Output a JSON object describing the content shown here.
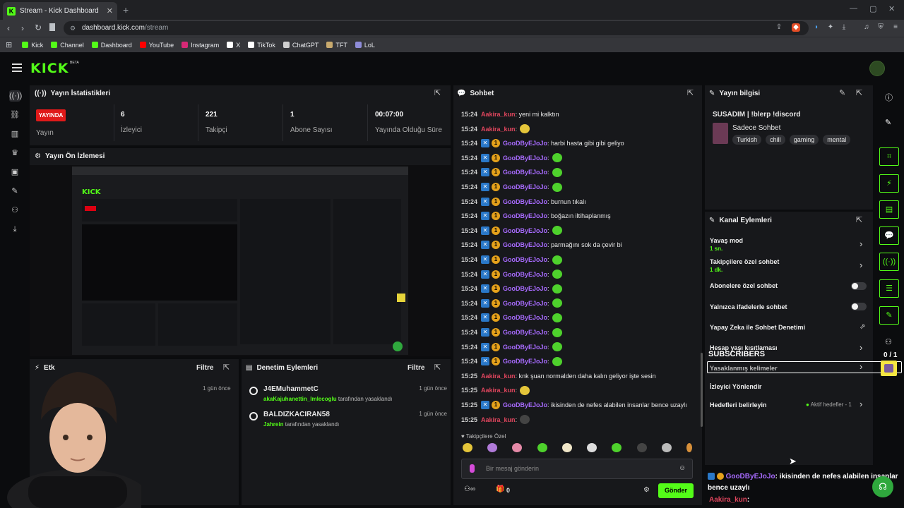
{
  "browser": {
    "tab_title": "Stream - Kick Dashboard",
    "url_domain": "dashboard.kick.com",
    "url_path": "/stream"
  },
  "bookmarks": [
    {
      "label": "Kick",
      "color": "#53fc18"
    },
    {
      "label": "Channel",
      "color": "#53fc18"
    },
    {
      "label": "Dashboard",
      "color": "#53fc18"
    },
    {
      "label": "YouTube",
      "color": "#ff0000"
    },
    {
      "label": "Instagram",
      "color": "#d62976"
    },
    {
      "label": "X",
      "color": "#ffffff"
    },
    {
      "label": "TikTok",
      "color": "#ffffff"
    },
    {
      "label": "ChatGPT",
      "color": "#cfcfcf"
    },
    {
      "label": "TFT",
      "color": "#c8aa6e"
    },
    {
      "label": "LoL",
      "color": "#8e8cd8"
    }
  ],
  "kick": {
    "logo": "KICK",
    "beta": "BETA"
  },
  "stats": {
    "title": "Yayın İstatistikleri",
    "live_badge": "YAYINDA",
    "items": [
      {
        "value": "",
        "label": "Yayın"
      },
      {
        "value": "6",
        "label": "İzleyici"
      },
      {
        "value": "221",
        "label": "Takipçi"
      },
      {
        "value": "1",
        "label": "Abone Sayısı"
      },
      {
        "value": "00:07:00",
        "label": "Yayında Olduğu Süre"
      }
    ]
  },
  "preview": {
    "title": "Yayın Ön İzlemesi"
  },
  "events": {
    "title": "Etk",
    "filter": "Filtre",
    "time": "1 gün önce"
  },
  "moderation": {
    "title": "Denetim Eylemleri",
    "filter": "Filtre",
    "items": [
      {
        "user": "J4EMuhammetC",
        "by": "akaKajuhanettin_lmlecoglu",
        "action": "tarafından yasaklandı",
        "time": "1 gün önce"
      },
      {
        "user": "BALDIZKACIRAN58",
        "by": "Jahrein",
        "action": "tarafından yasaklandı",
        "time": "1 gün önce"
      }
    ]
  },
  "chat": {
    "title": "Sohbet",
    "messages": [
      {
        "time": "15:24",
        "user": "Aakira_kun",
        "color": "#e0455d",
        "badges": false,
        "text": ": yeni mi kalktın",
        "emote": ""
      },
      {
        "time": "15:24",
        "user": "Aakira_kun",
        "color": "#e0455d",
        "badges": false,
        "text": ":",
        "emote": "y"
      },
      {
        "time": "15:24",
        "user": "GooDByEJoJo",
        "color": "#a86bff",
        "badges": true,
        "text": ": harbi hasta gibi gibi geliyo",
        "emote": ""
      },
      {
        "time": "15:24",
        "user": "GooDByEJoJo",
        "color": "#a86bff",
        "badges": true,
        "text": ":",
        "emote": "g"
      },
      {
        "time": "15:24",
        "user": "GooDByEJoJo",
        "color": "#a86bff",
        "badges": true,
        "text": ":",
        "emote": "g"
      },
      {
        "time": "15:24",
        "user": "GooDByEJoJo",
        "color": "#a86bff",
        "badges": true,
        "text": ":",
        "emote": "g"
      },
      {
        "time": "15:24",
        "user": "GooDByEJoJo",
        "color": "#a86bff",
        "badges": true,
        "text": ": burnun tıkalı",
        "emote": ""
      },
      {
        "time": "15:24",
        "user": "GooDByEJoJo",
        "color": "#a86bff",
        "badges": true,
        "text": ": boğazın iltihaplanmış",
        "emote": ""
      },
      {
        "time": "15:24",
        "user": "GooDByEJoJo",
        "color": "#a86bff",
        "badges": true,
        "text": ":",
        "emote": "g"
      },
      {
        "time": "15:24",
        "user": "GooDByEJoJo",
        "color": "#a86bff",
        "badges": true,
        "text": ": parmağını sok da çevir bi",
        "emote": ""
      },
      {
        "time": "15:24",
        "user": "GooDByEJoJo",
        "color": "#a86bff",
        "badges": true,
        "text": ":",
        "emote": "g"
      },
      {
        "time": "15:24",
        "user": "GooDByEJoJo",
        "color": "#a86bff",
        "badges": true,
        "text": ":",
        "emote": "g"
      },
      {
        "time": "15:24",
        "user": "GooDByEJoJo",
        "color": "#a86bff",
        "badges": true,
        "text": ":",
        "emote": "g"
      },
      {
        "time": "15:24",
        "user": "GooDByEJoJo",
        "color": "#a86bff",
        "badges": true,
        "text": ":",
        "emote": "g"
      },
      {
        "time": "15:24",
        "user": "GooDByEJoJo",
        "color": "#a86bff",
        "badges": true,
        "text": ":",
        "emote": "g"
      },
      {
        "time": "15:24",
        "user": "GooDByEJoJo",
        "color": "#a86bff",
        "badges": true,
        "text": ":",
        "emote": "g"
      },
      {
        "time": "15:24",
        "user": "GooDByEJoJo",
        "color": "#a86bff",
        "badges": true,
        "text": ":",
        "emote": "g"
      },
      {
        "time": "15:24",
        "user": "GooDByEJoJo",
        "color": "#a86bff",
        "badges": true,
        "text": ":",
        "emote": "g"
      },
      {
        "time": "15:25",
        "user": "Aakira_kun",
        "color": "#e0455d",
        "badges": false,
        "text": ": knk şuan normalden daha kalın geliyor işte sesin",
        "emote": ""
      },
      {
        "time": "15:25",
        "user": "Aakira_kun",
        "color": "#e0455d",
        "badges": false,
        "text": ":",
        "emote": "y"
      },
      {
        "time": "15:25",
        "user": "GooDByEJoJo",
        "color": "#a86bff",
        "badges": true,
        "text": ": ikisinden de nefes alabilen insanlar bence uzaylı",
        "emote": ""
      },
      {
        "time": "15:25",
        "user": "Aakira_kun",
        "color": "#e0455d",
        "badges": false,
        "text": ":",
        "emote": "d"
      }
    ],
    "followers_only": "Takipçilere Özel",
    "input_placeholder": "Bir mesaj gönderin",
    "count": "0",
    "send": "Gönder"
  },
  "stream_info": {
    "title": "Yayın bilgisi",
    "stream_title": "SUSADIM | !blerp !discord",
    "category": "Sadece Sohbet",
    "tags": [
      "Turkish",
      "chill",
      "gaming",
      "mental"
    ]
  },
  "channel_actions": {
    "title": "Kanal Eylemleri",
    "items": [
      {
        "label": "Yavaş mod",
        "sub": "1 sn.",
        "control": "chevron"
      },
      {
        "label": "Takipçilere özel sohbet",
        "sub": "1 dk.",
        "control": "chevron"
      },
      {
        "label": "Abonelere özel sohbet",
        "sub": "",
        "control": "toggle"
      },
      {
        "label": "Yalnızca ifadelerle sohbet",
        "sub": "",
        "control": "toggle"
      },
      {
        "label": "Yapay Zeka ile Sohbet Denetimi",
        "sub": "",
        "control": "external"
      },
      {
        "label": "Hesap yaşı kısıtlaması",
        "sub": "",
        "control": "chevron"
      },
      {
        "label": "Yasaklanmış kelimeler",
        "sub": "",
        "control": "chevron"
      },
      {
        "label": "İzleyici Yönlendir",
        "sub": "",
        "control": "none"
      },
      {
        "label": "Hedefleri belirleyin",
        "sub": "",
        "control": "chevron"
      }
    ],
    "goals_badge": "Aktif hedefler - 1"
  },
  "overlay": {
    "subscribers": "SUBSCRIBERS",
    "sub_count": "0 / 1",
    "chat_user": "GooDByEJoJo",
    "chat_text": ": ikisinden de nefes alabilen insanlar bence uzaylı",
    "chat_user2": "Aakira_kun",
    "chat_text2": ":"
  }
}
